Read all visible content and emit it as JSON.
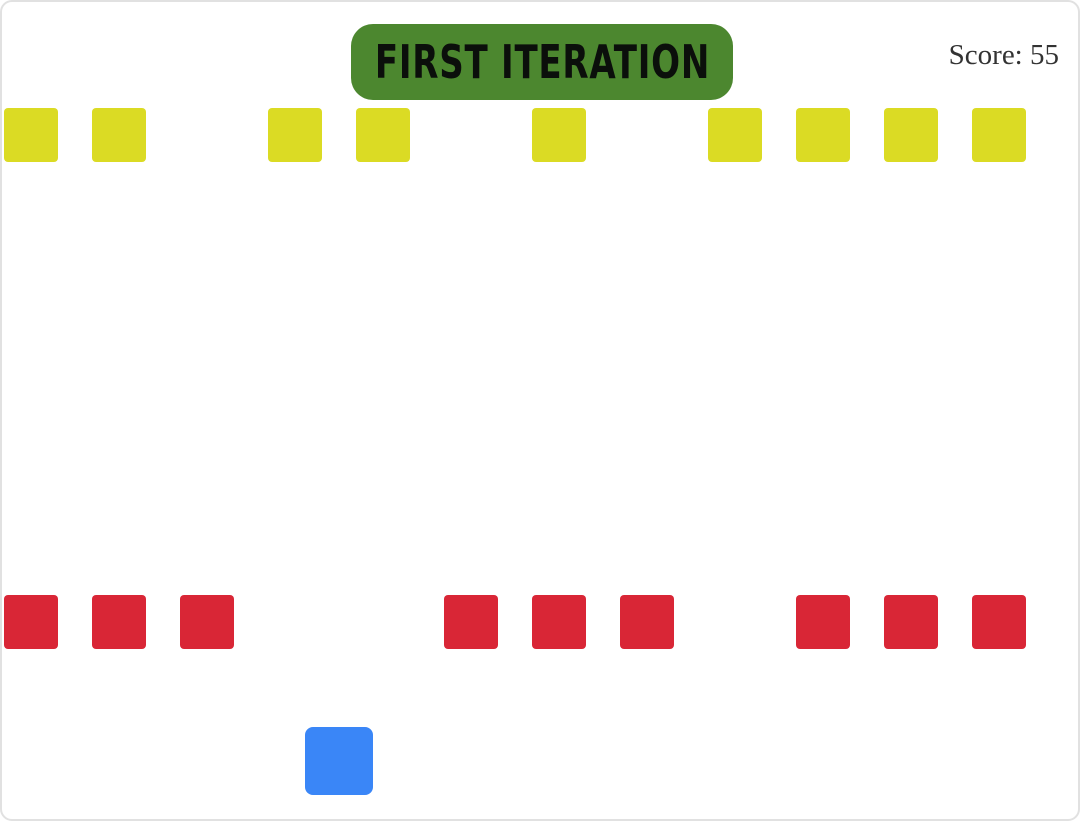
{
  "game": {
    "title": "FIRST ITERATION",
    "score_label": "Score: 55",
    "score": 55
  },
  "colors": {
    "title_badge": "#4c872f",
    "title_text": "#0b0f0b",
    "score_text": "#333333",
    "yellow_block": "#dbdb24",
    "red_block": "#d92636",
    "player": "#3a86f7",
    "frame_border": "#e1e1e1"
  },
  "rows": [
    {
      "name": "yellow",
      "color_key": "yellow_block",
      "slots": [
        true,
        true,
        false,
        true,
        true,
        false,
        true,
        false,
        true,
        true,
        true,
        true
      ]
    },
    {
      "name": "red",
      "color_key": "red_block",
      "slots": [
        true,
        true,
        true,
        false,
        false,
        true,
        true,
        true,
        false,
        true,
        true,
        true
      ]
    }
  ],
  "player": {
    "icon": "player-block-icon",
    "color_key": "player"
  }
}
